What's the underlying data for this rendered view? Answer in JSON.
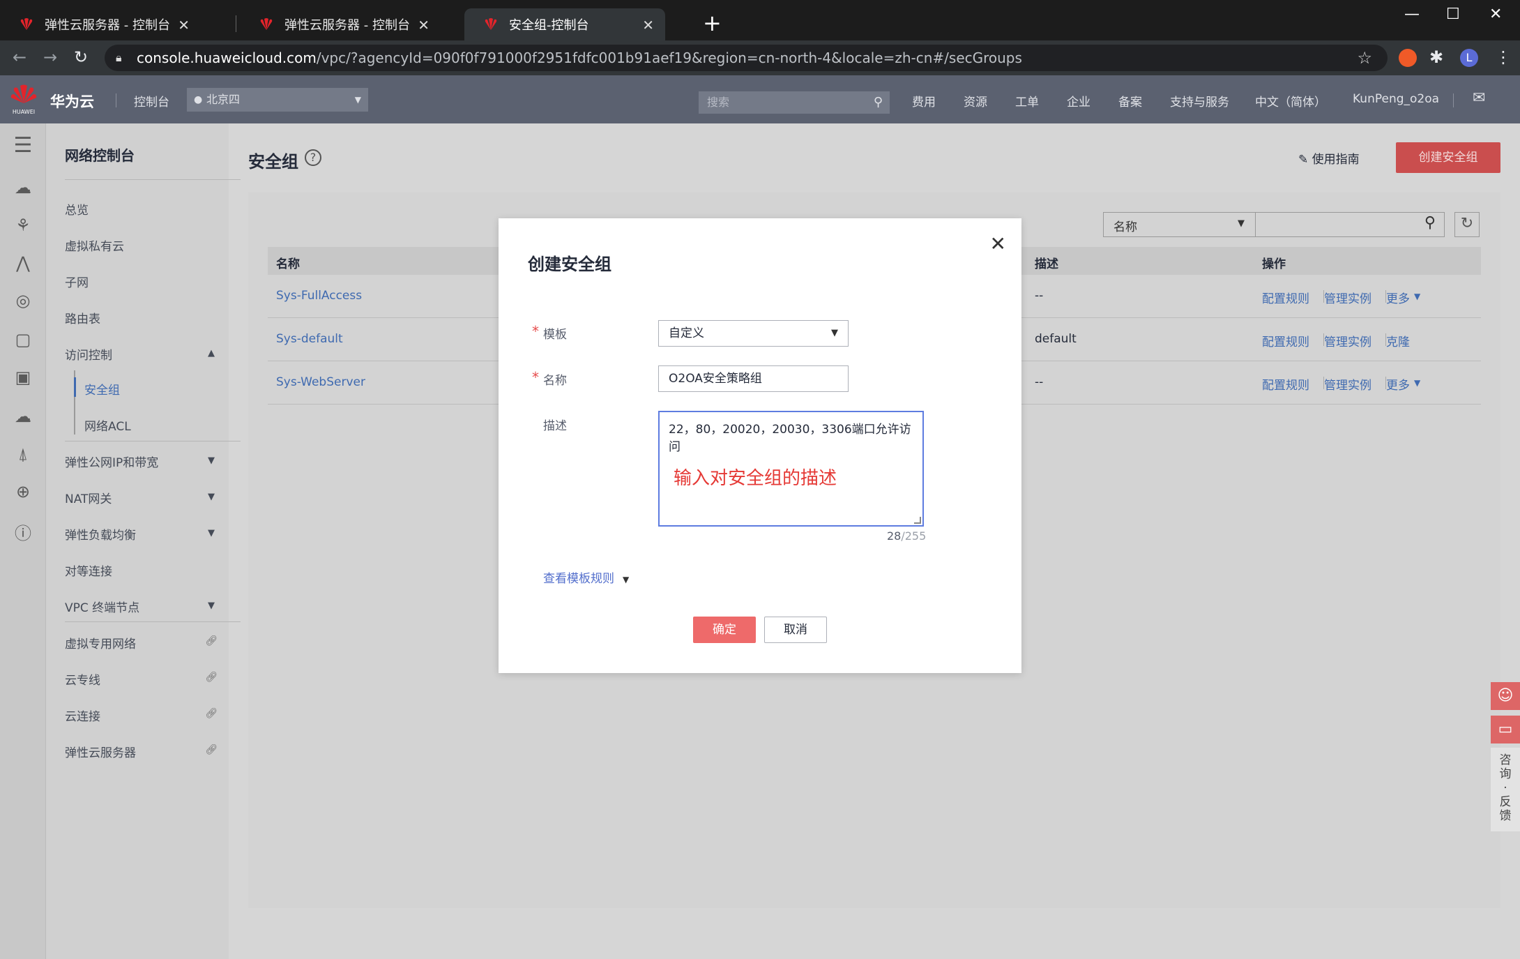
{
  "browser": {
    "tabs": [
      {
        "label": "弹性云服务器 - 控制台",
        "active": false
      },
      {
        "label": "弹性云服务器 - 控制台",
        "active": false
      },
      {
        "label": "安全组-控制台",
        "active": true
      }
    ],
    "url_host": "console.huaweicloud.com",
    "url_path": "/vpc/?agencyId=090f0f791000f2951fdfc001b91aef19&region=cn-north-4&locale=zh-cn#/secGroups",
    "profile_initial": "L"
  },
  "topnav": {
    "brand": "华为云",
    "logo_text": "HUAWEI",
    "console": "控制台",
    "region": "北京四",
    "search_placeholder": "搜索",
    "items": [
      "费用",
      "资源",
      "工单",
      "企业",
      "备案",
      "支持与服务",
      "中文（简体）",
      "KunPeng_o2oa"
    ]
  },
  "sidebar": {
    "title": "网络控制台",
    "items": [
      "总览",
      "虚拟私有云",
      "子网",
      "路由表",
      "访问控制",
      "安全组",
      "网络ACL",
      "弹性公网IP和带宽",
      "NAT网关",
      "弹性负载均衡",
      "对等连接",
      "VPC 终端节点",
      "虚拟专用网络",
      "云专线",
      "云连接",
      "弹性云服务器"
    ]
  },
  "main": {
    "title": "安全组",
    "guide": "使用指南",
    "create_button": "创建安全组",
    "filter_select": "名称",
    "columns": [
      "名称",
      "描述",
      "操作"
    ],
    "rows": [
      {
        "name": "Sys-FullAccess",
        "desc": "--",
        "ops": [
          "配置规则",
          "管理实例",
          "更多"
        ]
      },
      {
        "name": "Sys-default",
        "desc": "default",
        "ops": [
          "配置规则",
          "管理实例",
          "克隆"
        ]
      },
      {
        "name": "Sys-WebServer",
        "desc": "--",
        "ops": [
          "配置规则",
          "管理实例",
          "更多"
        ]
      }
    ]
  },
  "modal": {
    "title": "创建安全组",
    "template_label": "模板",
    "template_value": "自定义",
    "name_label": "名称",
    "name_value": "O2OA安全策略组",
    "desc_label": "描述",
    "desc_value": "22，80，20020，20030，3306端口允许访问",
    "annotation": "输入对安全组的描述",
    "counter_current": "28",
    "counter_max": "/255",
    "template_rules": "查看模板规则",
    "ok": "确定",
    "cancel": "取消"
  },
  "floating": {
    "feedback": "咨询·反馈"
  },
  "colors": {
    "primary_red": "#ee6a6a",
    "link_blue": "#526ecc",
    "focus_blue": "#5e7ce0"
  }
}
